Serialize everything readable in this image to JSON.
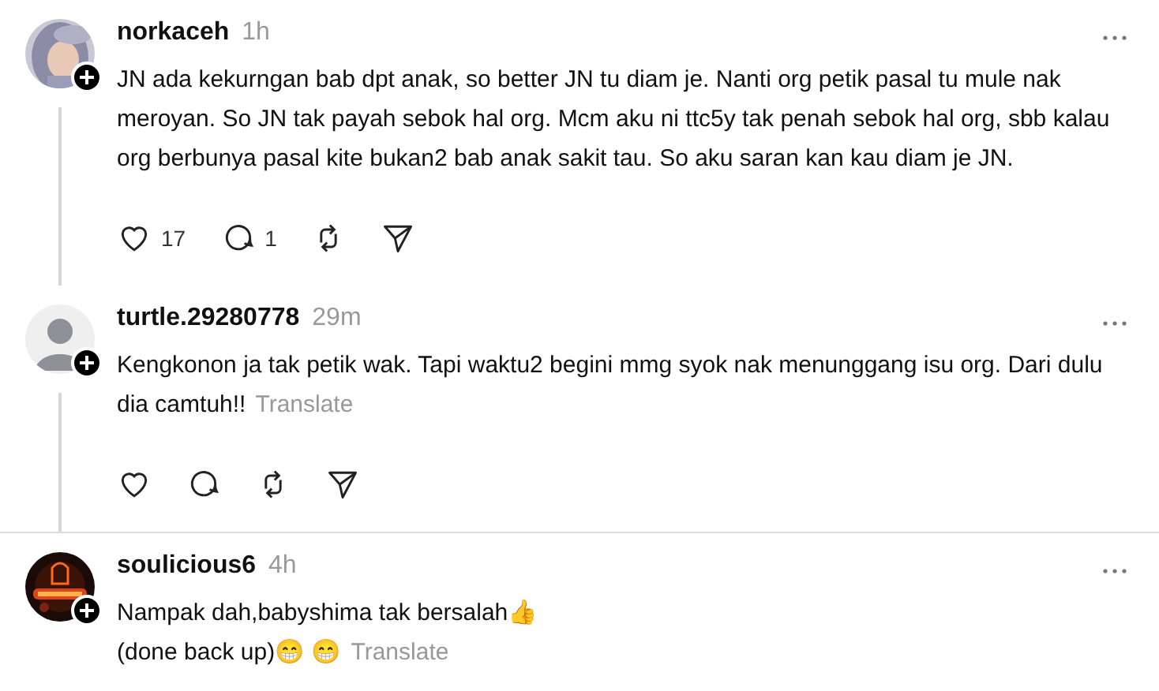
{
  "posts": [
    {
      "username": "norkaceh",
      "time": "1h",
      "text": "JN ada kekurngan bab dpt anak, so better JN tu diam je. Nanti org petik pasal tu mule nak meroyan. So JN tak payah sebok hal org. Mcm aku ni ttc5y tak penah sebok hal org, sbb kalau org berbunya pasal kite bukan2 bab anak sakit tau. So aku saran kan kau diam je JN.",
      "likes": "17",
      "replies": "1",
      "thread_line": true,
      "divider": false
    },
    {
      "username": "turtle.29280778",
      "time": "29m",
      "avatar": {
        "kind": "default"
      },
      "text": "Kengkonon ja tak petik wak. Tapi waktu2 begini mmg syok nak menunggang isu org. Dari dulu dia camtuh!!",
      "translate": "Translate",
      "thread_line": true,
      "divider": true
    },
    {
      "username": "soulicious6",
      "time": "4h",
      "avatar": {
        "kind": "neon"
      },
      "text": "Nampak dah,babyshima tak bersalah👍\n(done back up)😁 😁",
      "translate": "Translate",
      "thread_line": false,
      "divider": false,
      "actions_hidden": true
    }
  ]
}
